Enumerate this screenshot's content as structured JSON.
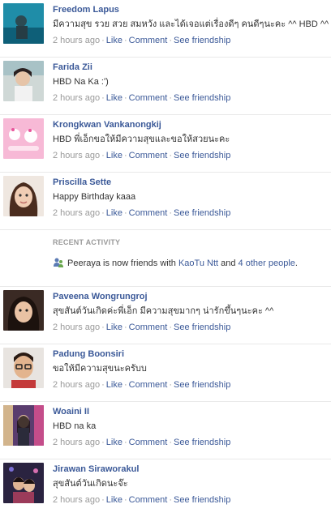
{
  "posts": [
    {
      "name": "Freedom Lapus",
      "message": "มีความสุข รวย สวย สมหวัง และได้เจอแต่เรื่องดีๆ คนดีๆนะคะ ^^ HBD ^^",
      "time": "2 hours ago",
      "like": "Like",
      "comment": "Comment",
      "friendship": "See friendship"
    },
    {
      "name": "Farida Zii",
      "message": "HBD Na Ka :')",
      "time": "2 hours ago",
      "like": "Like",
      "comment": "Comment",
      "friendship": "See friendship"
    },
    {
      "name": "Krongkwan Vankanongkij",
      "message": "HBD พี่เอ็กขอให้มีความสุขและขอให้สวยนะคะ",
      "time": "2 hours ago",
      "like": "Like",
      "comment": "Comment",
      "friendship": "See friendship"
    },
    {
      "name": "Priscilla Sette",
      "message": "Happy Birthday kaaa",
      "time": "2 hours ago",
      "like": "Like",
      "comment": "Comment",
      "friendship": "See friendship"
    }
  ],
  "recent_activity": {
    "title": "RECENT ACTIVITY",
    "text_before": "Peeraya is now friends with ",
    "link1": "KaoTu Ntt",
    "text_mid": " and ",
    "link2": "4 other people",
    "text_after": "."
  },
  "posts2": [
    {
      "name": "Paveena Wongrungroj",
      "message": "สุขสันต์วันเกิดค่ะพี่เอ็ก มีความสุขมากๆ น่ารักขึ้นๆนะคะ ^^",
      "time": "2 hours ago",
      "like": "Like",
      "comment": "Comment",
      "friendship": "See friendship"
    },
    {
      "name": "Padung Boonsiri",
      "message": "ขอให้มีความสุขนะครับบ",
      "time": "2 hours ago",
      "like": "Like",
      "comment": "Comment",
      "friendship": "See friendship"
    },
    {
      "name": "Woaini II",
      "message": "HBD na ka",
      "time": "2 hours ago",
      "like": "Like",
      "comment": "Comment",
      "friendship": "See friendship"
    },
    {
      "name": "Jirawan Siraworakul",
      "message": "สุขสันต์วันเกิดนะจ๊ะ",
      "time": "2 hours ago",
      "like": "Like",
      "comment": "Comment",
      "friendship": "See friendship"
    }
  ],
  "colors": {
    "link": "#3b5998",
    "meta": "#999999",
    "divider": "#e9e9e9"
  }
}
